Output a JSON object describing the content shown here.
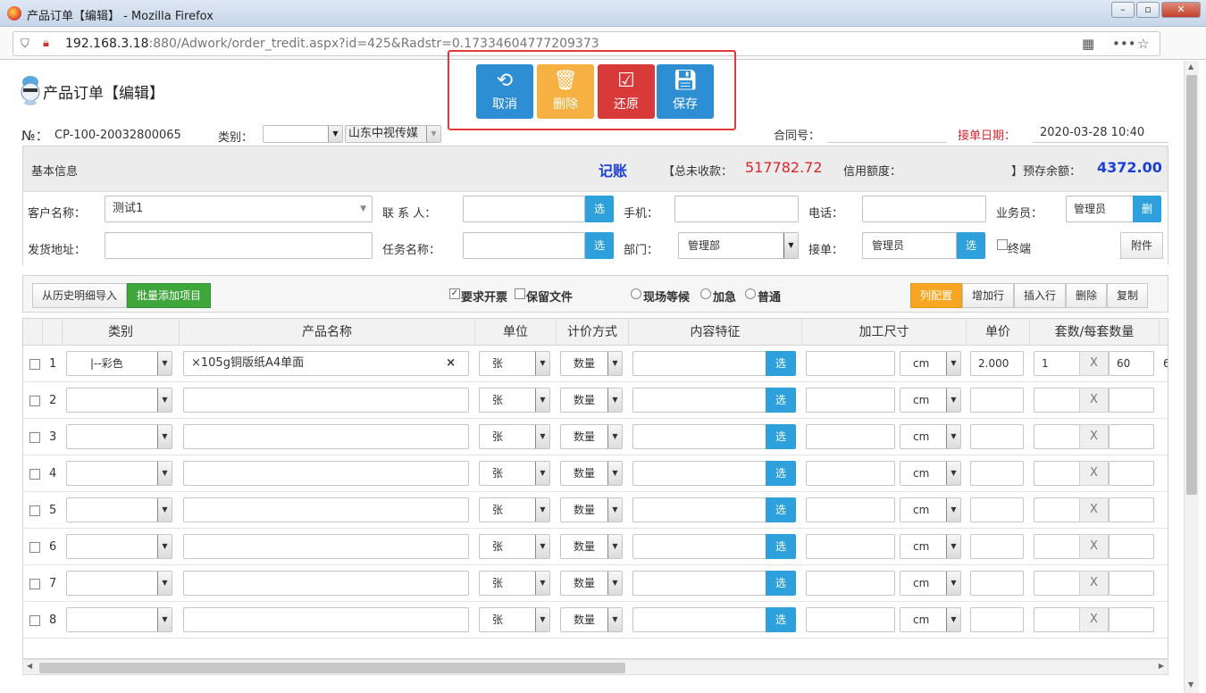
{
  "window": {
    "title": "产品订单【编辑】 - Mozilla Firefox"
  },
  "browser": {
    "url_host": "192.168.3.18",
    "url_rest": ":880/Adwork/order_tredit.aspx?id=425&Radstr=0.17334604777209373"
  },
  "page": {
    "title": "产品订单【编辑】"
  },
  "actions": {
    "cancel": "取消",
    "delete": "删除",
    "restore": "还原",
    "save": "保存"
  },
  "header": {
    "no_label": "№：",
    "no_value": "CP-100-20032800065",
    "category_label": "类别：",
    "company": "山东中视传媒",
    "contract_label": "合同号：",
    "date_label": "接单日期：",
    "date_value": "2020-03-28 10:40"
  },
  "info": {
    "section": "基本信息",
    "jizhang": "记账",
    "unpaid_label": "【总未收款：",
    "unpaid_value": "517782.72",
    "credit_label": "信用额度：",
    "prepay_label": "】预存余额：",
    "prepay_value": "4372.00",
    "customer_label": "客户名称：",
    "customer_value": "测试1",
    "contact_label": "联 系 人：",
    "mobile_label": "手机：",
    "phone_label": "电话：",
    "sales_label": "业务员：",
    "sales_value": "管理员",
    "del_btn": "删",
    "address_label": "发货地址：",
    "task_label": "任务名称：",
    "dept_label": "部门：",
    "dept_value": "管理部",
    "receiver_label": "接单：",
    "receiver_value": "管理员",
    "terminal_label": "终端",
    "attach_btn": "附件",
    "select_btn": "选"
  },
  "toolbar": {
    "import_btn": "从历史明细导入",
    "batch_btn": "批量添加项目",
    "invoice": "要求开票",
    "keep_file": "保留文件",
    "opt_wait": "现场等候",
    "opt_urgent": "加急",
    "opt_normal": "普通",
    "col_config": "列配置",
    "add_row": "增加行",
    "insert_row": "插入行",
    "delete": "删除",
    "copy": "复制"
  },
  "grid": {
    "headers": [
      "类别",
      "产品名称",
      "单位",
      "计价方式",
      "内容特征",
      "加工尺寸",
      "单价",
      "套数/每套数量"
    ],
    "rows": [
      {
        "n": "1",
        "category": "|--彩色",
        "product": "×105g铜版纸A4单面",
        "unit": "张",
        "pricing": "数量",
        "size_unit": "cm",
        "price": "2.000",
        "sets": "1",
        "per": "60",
        "extra": "6"
      },
      {
        "n": "2",
        "category": "",
        "product": "",
        "unit": "张",
        "pricing": "数量",
        "size_unit": "cm",
        "price": "",
        "sets": "",
        "per": "",
        "extra": ""
      },
      {
        "n": "3",
        "category": "",
        "product": "",
        "unit": "张",
        "pricing": "数量",
        "size_unit": "cm",
        "price": "",
        "sets": "",
        "per": "",
        "extra": ""
      },
      {
        "n": "4",
        "category": "",
        "product": "",
        "unit": "张",
        "pricing": "数量",
        "size_unit": "cm",
        "price": "",
        "sets": "",
        "per": "",
        "extra": ""
      },
      {
        "n": "5",
        "category": "",
        "product": "",
        "unit": "张",
        "pricing": "数量",
        "size_unit": "cm",
        "price": "",
        "sets": "",
        "per": "",
        "extra": ""
      },
      {
        "n": "6",
        "category": "",
        "product": "",
        "unit": "张",
        "pricing": "数量",
        "size_unit": "cm",
        "price": "",
        "sets": "",
        "per": "",
        "extra": ""
      },
      {
        "n": "7",
        "category": "",
        "product": "",
        "unit": "张",
        "pricing": "数量",
        "size_unit": "cm",
        "price": "",
        "sets": "",
        "per": "",
        "extra": ""
      },
      {
        "n": "8",
        "category": "",
        "product": "",
        "unit": "张",
        "pricing": "数量",
        "size_unit": "cm",
        "price": "",
        "sets": "",
        "per": "",
        "extra": ""
      }
    ],
    "select_btn": "选",
    "times": "X"
  },
  "colors": {
    "primary": "#2e8ed3",
    "warning": "#f6b142",
    "danger": "#d83a3a",
    "success": "#3fa63c",
    "orange": "#f6a623"
  }
}
